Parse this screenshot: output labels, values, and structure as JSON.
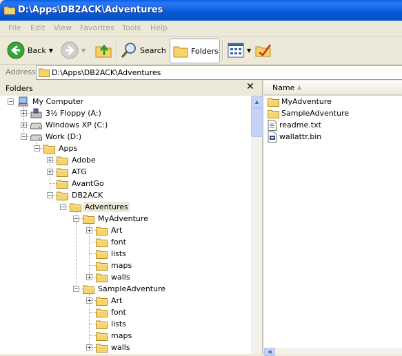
{
  "window": {
    "title": "D:\\Apps\\DB2ACK\\Adventures"
  },
  "menu": [
    "File",
    "Edit",
    "View",
    "Favorites",
    "Tools",
    "Help"
  ],
  "toolbar": {
    "back": "Back",
    "search": "Search",
    "folders": "Folders"
  },
  "address": {
    "label": "Address",
    "value": "D:\\Apps\\DB2ACK\\Adventures"
  },
  "folders_pane": {
    "title": "Folders",
    "close": "✕"
  },
  "tree": [
    {
      "label": "My Computer",
      "icon": "computer-icon",
      "level": 0,
      "exp": "minus"
    },
    {
      "label": "3½ Floppy (A:)",
      "icon": "floppy-icon",
      "level": 1,
      "exp": "plus"
    },
    {
      "label": "Windows XP (C:)",
      "icon": "drive-icon",
      "level": 1,
      "exp": "plus"
    },
    {
      "label": "Work (D:)",
      "icon": "drive-icon",
      "level": 1,
      "exp": "minus"
    },
    {
      "label": "Apps",
      "icon": "folder-icon",
      "level": 2,
      "exp": "minus"
    },
    {
      "label": "Adobe",
      "icon": "folder-icon",
      "level": 3,
      "exp": "plus"
    },
    {
      "label": "ATG",
      "icon": "folder-icon",
      "level": 3,
      "exp": "plus"
    },
    {
      "label": "AvantGo",
      "icon": "folder-icon",
      "level": 3,
      "exp": ""
    },
    {
      "label": "DB2ACK",
      "icon": "folder-icon",
      "level": 3,
      "exp": "minus"
    },
    {
      "label": "Adventures",
      "icon": "folder-icon",
      "level": 4,
      "exp": "minus",
      "selected": true
    },
    {
      "label": "MyAdventure",
      "icon": "folder-icon",
      "level": 5,
      "exp": "minus"
    },
    {
      "label": "Art",
      "icon": "folder-icon",
      "level": 6,
      "exp": "plus"
    },
    {
      "label": "font",
      "icon": "folder-icon",
      "level": 6,
      "exp": ""
    },
    {
      "label": "lists",
      "icon": "folder-icon",
      "level": 6,
      "exp": ""
    },
    {
      "label": "maps",
      "icon": "folder-icon",
      "level": 6,
      "exp": ""
    },
    {
      "label": "walls",
      "icon": "folder-icon",
      "level": 6,
      "exp": "plus"
    },
    {
      "label": "SampleAdventure",
      "icon": "folder-icon",
      "level": 5,
      "exp": "minus"
    },
    {
      "label": "Art",
      "icon": "folder-icon",
      "level": 6,
      "exp": "plus"
    },
    {
      "label": "font",
      "icon": "folder-icon",
      "level": 6,
      "exp": ""
    },
    {
      "label": "lists",
      "icon": "folder-icon",
      "level": 6,
      "exp": ""
    },
    {
      "label": "maps",
      "icon": "folder-icon",
      "level": 6,
      "exp": ""
    },
    {
      "label": "walls",
      "icon": "folder-icon",
      "level": 6,
      "exp": "plus"
    }
  ],
  "files": {
    "column_name": "Name",
    "items": [
      {
        "label": "MyAdventure",
        "icon": "folder-icon"
      },
      {
        "label": "SampleAdventure",
        "icon": "folder-icon"
      },
      {
        "label": "readme.txt",
        "icon": "text-file-icon"
      },
      {
        "label": "wallattr.bin",
        "icon": "binary-file-icon"
      }
    ]
  },
  "colors": {
    "titlebar": "#0a58d8",
    "folder": "#f6d36b"
  }
}
